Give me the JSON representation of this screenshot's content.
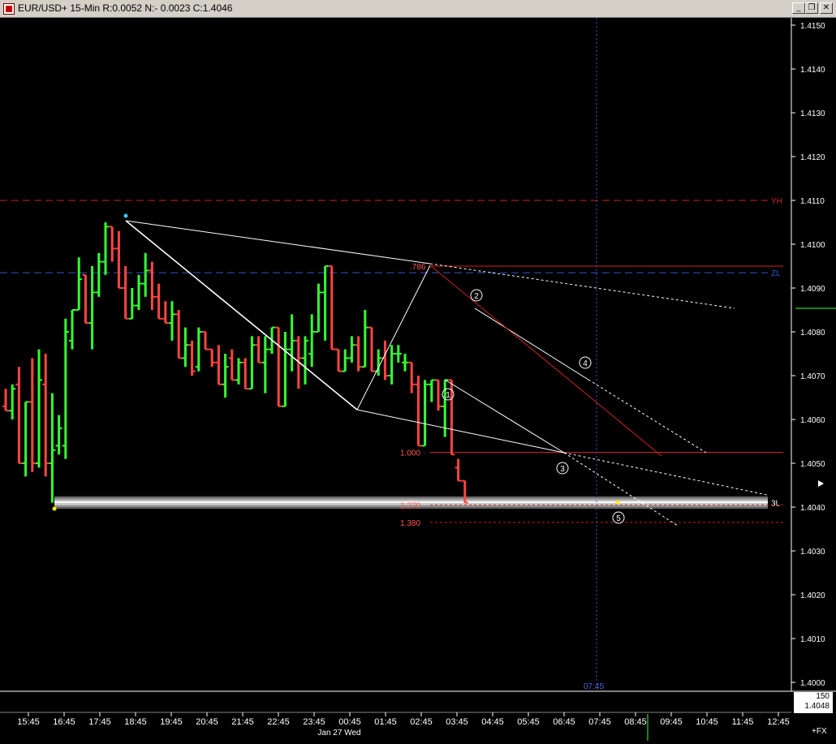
{
  "window": {
    "title": "EUR/USD+ 15-Min R:0.0052 N:- 0.0023 C:1.4046",
    "minimize_glyph": "_",
    "restore_glyph": "❐",
    "close_glyph": "✕"
  },
  "colors": {
    "up_bar": "#33ff33",
    "down_bar": "#ff4444",
    "trendline": "#ffffff",
    "yh_line": "#cc2222",
    "zl_line": "#3355cc",
    "fib_line": "#cc2222",
    "fib_label": "#ff5555",
    "axis_text": "#ffffff"
  },
  "price_info": {
    "count": "150",
    "price": "1.4048"
  },
  "fx_label": "+FX",
  "cursor_time": "07:45",
  "date_label": "Jan 27 Wed",
  "chart_data": {
    "type": "bar",
    "instrument": "EUR/USD+",
    "timeframe": "15-Min",
    "ylim": [
      1.4,
      1.415
    ],
    "y_ticks": [
      "1.4000",
      "1.4010",
      "1.4020",
      "1.4030",
      "1.4040",
      "1.4050",
      "1.4060",
      "1.4070",
      "1.4080",
      "1.4090",
      "1.4100",
      "1.4110",
      "1.4120",
      "1.4130",
      "1.4140",
      "1.4150"
    ],
    "y_tick_values": [
      1.4,
      1.401,
      1.402,
      1.403,
      1.404,
      1.405,
      1.406,
      1.407,
      1.408,
      1.409,
      1.41,
      1.411,
      1.412,
      1.413,
      1.414,
      1.415
    ],
    "x_ticks": [
      "15:45",
      "16:45",
      "17:45",
      "18:45",
      "19:45",
      "20:45",
      "21:45",
      "22:45",
      "23:45",
      "00:45",
      "01:45",
      "02:45",
      "03:45",
      "04:45",
      "05:45",
      "06:45",
      "07:45",
      "08:45",
      "09:45",
      "10:45",
      "11:45",
      "12:45"
    ],
    "bar_interval_minutes": 15,
    "start_time": "15:15",
    "bars": [
      [
        1.4063,
        1.4067,
        1.4062,
        1.4062
      ],
      [
        1.4062,
        1.4068,
        1.406,
        1.4067
      ],
      [
        1.4068,
        1.4072,
        1.405,
        1.405
      ],
      [
        1.405,
        1.4064,
        1.4047,
        1.4064
      ],
      [
        1.4064,
        1.4074,
        1.4048,
        1.405
      ],
      [
        1.405,
        1.4076,
        1.4049,
        1.4069
      ],
      [
        1.4068,
        1.4075,
        1.4047,
        1.405
      ],
      [
        1.405,
        1.4066,
        1.4041,
        1.4053
      ],
      [
        1.4054,
        1.4061,
        1.4052,
        1.4058
      ],
      [
        1.4054,
        1.4083,
        1.4051,
        1.408
      ],
      [
        1.4078,
        1.4085,
        1.4076,
        1.4085
      ],
      [
        1.4085,
        1.4097,
        1.4087,
        1.4092
      ],
      [
        1.4093,
        1.409,
        1.4082,
        1.4082
      ],
      [
        1.4082,
        1.4095,
        1.4076,
        1.4089
      ],
      [
        1.4089,
        1.4098,
        1.4088,
        1.4096
      ],
      [
        1.4096,
        1.4105,
        1.4093,
        1.4104
      ],
      [
        1.4104,
        1.4101,
        1.4096,
        1.4099
      ],
      [
        1.4099,
        1.4103,
        1.409,
        1.409
      ],
      [
        1.409,
        1.4095,
        1.4083,
        1.4083
      ],
      [
        1.4083,
        1.409,
        1.4086,
        1.4086
      ],
      [
        1.4086,
        1.4093,
        1.4085,
        1.4091
      ],
      [
        1.4091,
        1.4098,
        1.4088,
        1.4094
      ],
      [
        1.4094,
        1.4096,
        1.4085,
        1.4088
      ],
      [
        1.4088,
        1.4091,
        1.4083,
        1.4083
      ],
      [
        1.4083,
        1.4087,
        1.4082,
        1.4082
      ],
      [
        1.4082,
        1.4087,
        1.4078,
        1.4084
      ],
      [
        1.4084,
        1.4085,
        1.4074,
        1.4074
      ],
      [
        1.4074,
        1.4081,
        1.4072,
        1.4077
      ],
      [
        1.4077,
        1.4078,
        1.407,
        1.4071
      ],
      [
        1.4072,
        1.4081,
        1.4071,
        1.408
      ],
      [
        1.408,
        1.4078,
        1.4076,
        1.4076
      ],
      [
        1.4076,
        1.4074,
        1.4072,
        1.4073
      ],
      [
        1.4073,
        1.4077,
        1.4068,
        1.4068
      ],
      [
        1.4068,
        1.4075,
        1.4065,
        1.4072
      ],
      [
        1.4074,
        1.4076,
        1.4069,
        1.4069
      ],
      [
        1.4069,
        1.4074,
        1.4068,
        1.4073
      ],
      [
        1.4073,
        1.4074,
        1.4067,
        1.4067
      ],
      [
        1.4067,
        1.4079,
        1.4069,
        1.4077
      ],
      [
        1.4077,
        1.4079,
        1.4073,
        1.4073
      ],
      [
        1.4073,
        1.4079,
        1.4066,
        1.4076
      ],
      [
        1.4076,
        1.4081,
        1.4075,
        1.4081
      ],
      [
        1.4081,
        1.407,
        1.4063,
        1.4063
      ],
      [
        1.4063,
        1.408,
        1.4068,
        1.4076
      ],
      [
        1.4076,
        1.4084,
        1.4071,
        1.4078
      ],
      [
        1.4078,
        1.4079,
        1.4067,
        1.4074
      ],
      [
        1.4074,
        1.4079,
        1.4068,
        1.4078
      ],
      [
        1.4075,
        1.4084,
        1.4072,
        1.408
      ],
      [
        1.408,
        1.4091,
        1.408,
        1.4089
      ],
      [
        1.4089,
        1.4095,
        1.4078,
        1.4095
      ],
      [
        1.4095,
        1.4089,
        1.4076,
        1.4076
      ],
      [
        1.4076,
        1.4073,
        1.4071,
        1.4071
      ],
      [
        1.4071,
        1.4076,
        1.4072,
        1.4074
      ],
      [
        1.4074,
        1.4079,
        1.4073,
        1.4077
      ],
      [
        1.4077,
        1.4079,
        1.4071,
        1.4072
      ],
      [
        1.4072,
        1.4085,
        1.4075,
        1.4081
      ],
      [
        1.4081,
        1.4078,
        1.4071,
        1.4071
      ],
      [
        1.4071,
        1.4076,
        1.407,
        1.4074
      ],
      [
        1.4074,
        1.4078,
        1.4069,
        1.407
      ],
      [
        1.407,
        1.4077,
        1.4068,
        1.4075
      ],
      [
        1.4075,
        1.4077,
        1.4073,
        1.4075
      ],
      [
        1.4073,
        1.4075,
        1.4071,
        1.4073
      ],
      [
        1.4073,
        1.4072,
        1.4066,
        1.4068
      ],
      [
        1.4068,
        1.407,
        1.4054,
        1.4054
      ],
      [
        1.4054,
        1.4069,
        1.4054,
        1.4068
      ],
      [
        1.4068,
        1.4069,
        1.4064,
        1.4069
      ],
      [
        1.4069,
        1.4069,
        1.4062,
        1.4063
      ],
      [
        1.4063,
        1.4069,
        1.4056,
        1.4069
      ],
      [
        1.4069,
        1.4069,
        1.4052,
        1.4052
      ],
      [
        1.4049,
        1.4051,
        1.4046,
        1.4046
      ],
      [
        1.4046,
        1.4045,
        1.4041,
        1.4041
      ]
    ],
    "horizontal_lines": [
      {
        "label": "YH",
        "value": 1.411,
        "style": "dashed"
      },
      {
        "label": "ZL",
        "value": 1.40935,
        "style": "dashed"
      },
      {
        "label": "3L",
        "value": 1.4041,
        "style": "band"
      }
    ],
    "fib_levels": [
      {
        "label": ".786",
        "value": 1.4095
      },
      {
        "label": "1.000",
        "value": 1.40525
      },
      {
        "label": "1.270",
        "value": 1.40405
      },
      {
        "label": "1.380",
        "value": 1.40365
      }
    ],
    "wave_labels": [
      "1",
      "2",
      "3",
      "4",
      "5"
    ],
    "grid": false
  }
}
